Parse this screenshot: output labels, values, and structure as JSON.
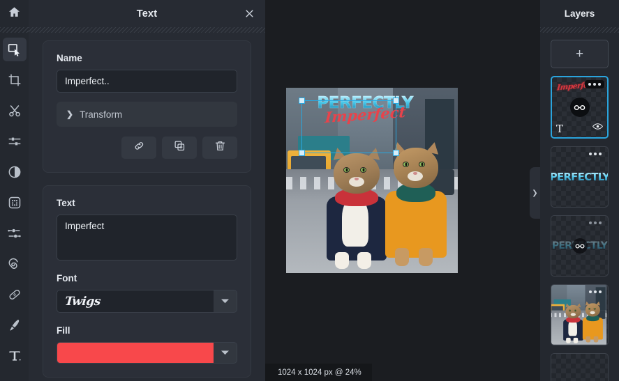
{
  "toolbar": {
    "home_label": "Home",
    "tools": [
      {
        "name": "select-tool",
        "label": "Select",
        "active": true
      },
      {
        "name": "crop-tool",
        "label": "Crop",
        "active": false
      },
      {
        "name": "cut-tool",
        "label": "Cut",
        "active": false
      },
      {
        "name": "adjust-tool",
        "label": "Adjustments",
        "active": false
      },
      {
        "name": "contrast-tool",
        "label": "Contrast",
        "active": false
      },
      {
        "name": "dither-tool",
        "label": "Dither",
        "active": false
      },
      {
        "name": "nodes-tool",
        "label": "Nodes",
        "active": false
      },
      {
        "name": "smudge-tool",
        "label": "Smudge",
        "active": false
      },
      {
        "name": "heal-tool",
        "label": "Heal",
        "active": false
      },
      {
        "name": "brush-tool",
        "label": "Brush",
        "active": false
      },
      {
        "name": "text-tool",
        "label": "Text",
        "active": false
      }
    ]
  },
  "panel": {
    "title": "Text",
    "close_label": "×",
    "name_section": {
      "label": "Name",
      "value": "Imperfect..",
      "placeholder": "Name"
    },
    "transform": {
      "label": "Transform",
      "chevron": "❯",
      "expanded": false
    },
    "actions": [
      {
        "name": "link-button",
        "label": "Link"
      },
      {
        "name": "duplicate-button",
        "label": "Duplicate"
      },
      {
        "name": "delete-button",
        "label": "Delete"
      }
    ],
    "text_section": {
      "label": "Text",
      "value": "Imperfect",
      "placeholder": "Enter text"
    },
    "font_section": {
      "label": "Font",
      "value": "Twigs"
    },
    "fill_section": {
      "label": "Fill",
      "color": "#f8484b"
    }
  },
  "canvas": {
    "status": "1024 x 1024 px @ 24%",
    "document_size": "1024 x 1024 px",
    "zoom": "24%",
    "collapse_chevron": "❯",
    "artwork": {
      "headline_top": "PERFECTLY",
      "headline_bottom": "Imperfect",
      "headline_top_color": "#46c6e8",
      "headline_bottom_color": "#e8434b"
    },
    "selection": {
      "visible": true,
      "handle_color": "#29a8e0"
    }
  },
  "layers": {
    "title": "Layers",
    "add_label": "+",
    "items": [
      {
        "name": "layer-imperfect-text",
        "thumb_text": "Imperfect",
        "type": "text",
        "type_icon": "T",
        "selected": true,
        "linked": true,
        "visible": true,
        "menu": "•••"
      },
      {
        "name": "layer-perfectly-text",
        "thumb_text": "PERFECTLY",
        "type": "text",
        "selected": false,
        "linked": false,
        "visible": true,
        "menu": "•••"
      },
      {
        "name": "layer-perfectly-text-hidden",
        "thumb_text": "PERFECTLY",
        "type": "text",
        "selected": false,
        "linked": true,
        "visible": false,
        "menu": "•••"
      },
      {
        "name": "layer-cats-photo",
        "thumb_text": "",
        "type": "image",
        "selected": false,
        "linked": false,
        "visible": true,
        "menu": "•••"
      },
      {
        "name": "layer-empty",
        "thumb_text": "",
        "type": "empty",
        "selected": false,
        "linked": false,
        "visible": true,
        "menu": ""
      }
    ]
  }
}
